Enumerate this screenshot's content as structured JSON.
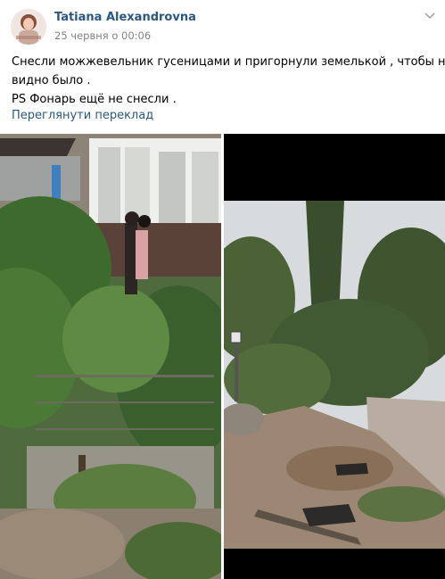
{
  "post": {
    "author": "Tatiana Alexandrovna",
    "date": "25 червня о 00:06",
    "text_lines": [
      "Снесли можжевельник гусеницами и пригорнули земелькой , чтобы не",
      "видно было .",
      "PS Фонарь ещё не снесли ."
    ],
    "translate_link": "Переглянути переклад"
  },
  "icons": {
    "more": "chevron-down-icon"
  },
  "colors": {
    "link": "#2a5885",
    "meta": "#828282"
  }
}
